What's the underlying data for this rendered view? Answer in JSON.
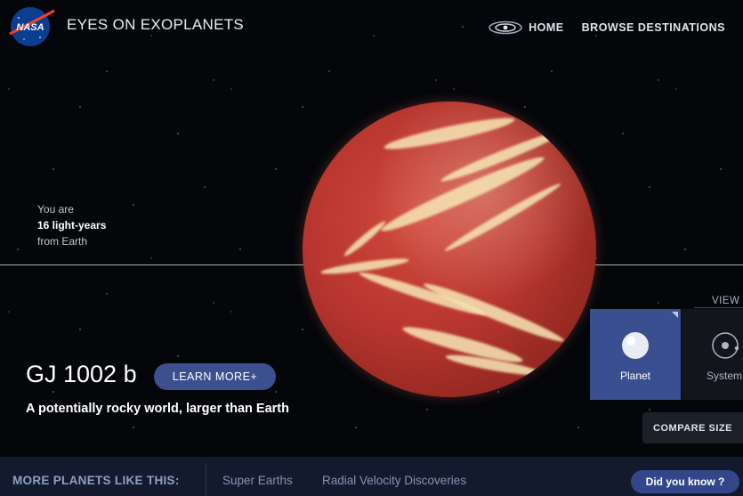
{
  "header": {
    "logo_text": "NASA",
    "title": "EYES ON EXOPLANETS",
    "nav": {
      "home_label": "HOME",
      "browse_label": "BROWSE DESTINATIONS"
    }
  },
  "distance": {
    "line1": "You are",
    "line2": "16 light-years",
    "line3": "from Earth"
  },
  "planet": {
    "name": "GJ 1002 b",
    "learn_more_label": "LEARN MORE+",
    "tagline": "A potentially rocky world, larger than Earth"
  },
  "view_panel": {
    "label": "VIEW",
    "options": [
      {
        "label": "Planet",
        "selected": true
      },
      {
        "label": "System",
        "selected": false
      }
    ],
    "compare_label": "COMPARE SIZE"
  },
  "bottom_bar": {
    "label": "MORE PLANETS LIKE THIS:",
    "links": [
      "Super Earths",
      "Radial Velocity Discoveries"
    ],
    "did_you_know_label": "Did you know ?"
  },
  "colors": {
    "accent_blue": "#3c4f8f",
    "bar_bg": "#131a2e",
    "planet_red": "#b8362f",
    "cloud_cream": "#f6e6b4"
  }
}
